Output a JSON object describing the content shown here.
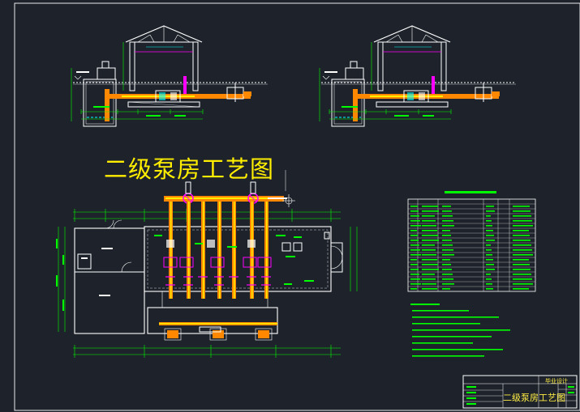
{
  "drawing": {
    "title": "二级泵房工艺图",
    "title_block": {
      "drawing_name": "二级泵房工艺图",
      "stage": "毕业设计"
    },
    "colors": {
      "background": "#1e232b",
      "outline": "#ffffff",
      "dimension": "#00ff00",
      "pipe_primary": "#ff8800",
      "pipe_secondary": "#ffee00",
      "pipe_tertiary": "#ff00ff",
      "roof": "#ffffff",
      "table": "#00ff00",
      "accent_cyan": "#00ffff"
    },
    "icons": [
      "pump-icon",
      "valve-icon",
      "door-icon",
      "north-arrow-icon"
    ]
  }
}
